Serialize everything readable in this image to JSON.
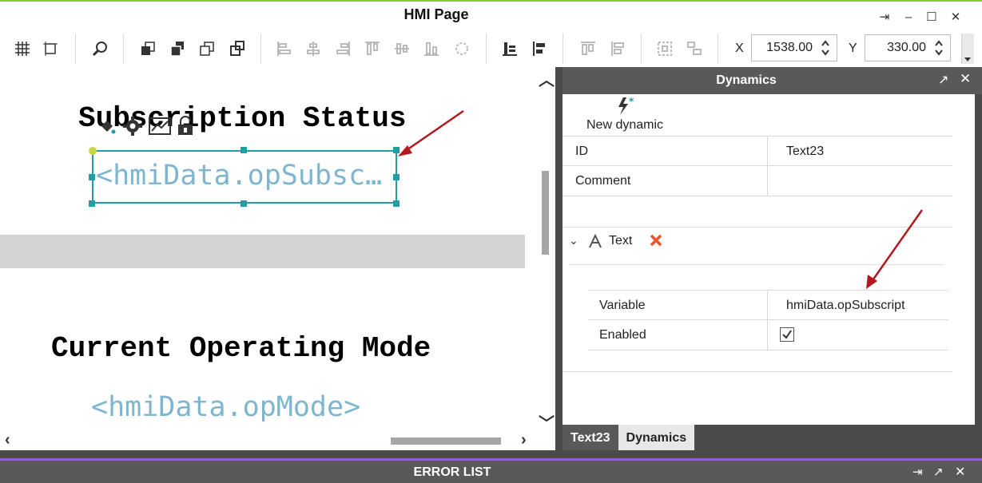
{
  "window": {
    "title": "HMI Page",
    "controls": [
      "pin-icon",
      "minimize-icon",
      "maximize-icon",
      "close-icon"
    ]
  },
  "toolbar": {
    "x_label": "X",
    "x_value": "1538.00",
    "y_label": "Y",
    "y_value": "330.00"
  },
  "canvas": {
    "title1": "Subscription Status",
    "value1": "<hmiData.opSubsc…",
    "title2": "Current Operating Mode",
    "value2": "<hmiData.opMode>"
  },
  "dynamics": {
    "title": "Dynamics",
    "new_dynamic_label": "New dynamic",
    "rows": [
      {
        "key": "ID",
        "value": "Text23"
      },
      {
        "key": "Comment",
        "value": ""
      }
    ],
    "text_section": {
      "label": "Text",
      "rows": [
        {
          "key": "Variable",
          "value": "hmiData.opSubscript"
        },
        {
          "key": "Enabled",
          "value": ""
        }
      ],
      "enabled": true
    },
    "tabs": [
      {
        "label": "Text23",
        "active": false
      },
      {
        "label": "Dynamics",
        "active": true
      }
    ]
  },
  "error_list": {
    "title": "ERROR LIST"
  },
  "colors": {
    "accent_green": "#8ac926",
    "selection_teal": "#1f9ea3",
    "value_text": "#7fb6cf",
    "delete_red": "#f0522c",
    "arrow_red": "#b3191c",
    "panel_dark": "#4a4a4a",
    "error_border": "#9b59d0"
  }
}
